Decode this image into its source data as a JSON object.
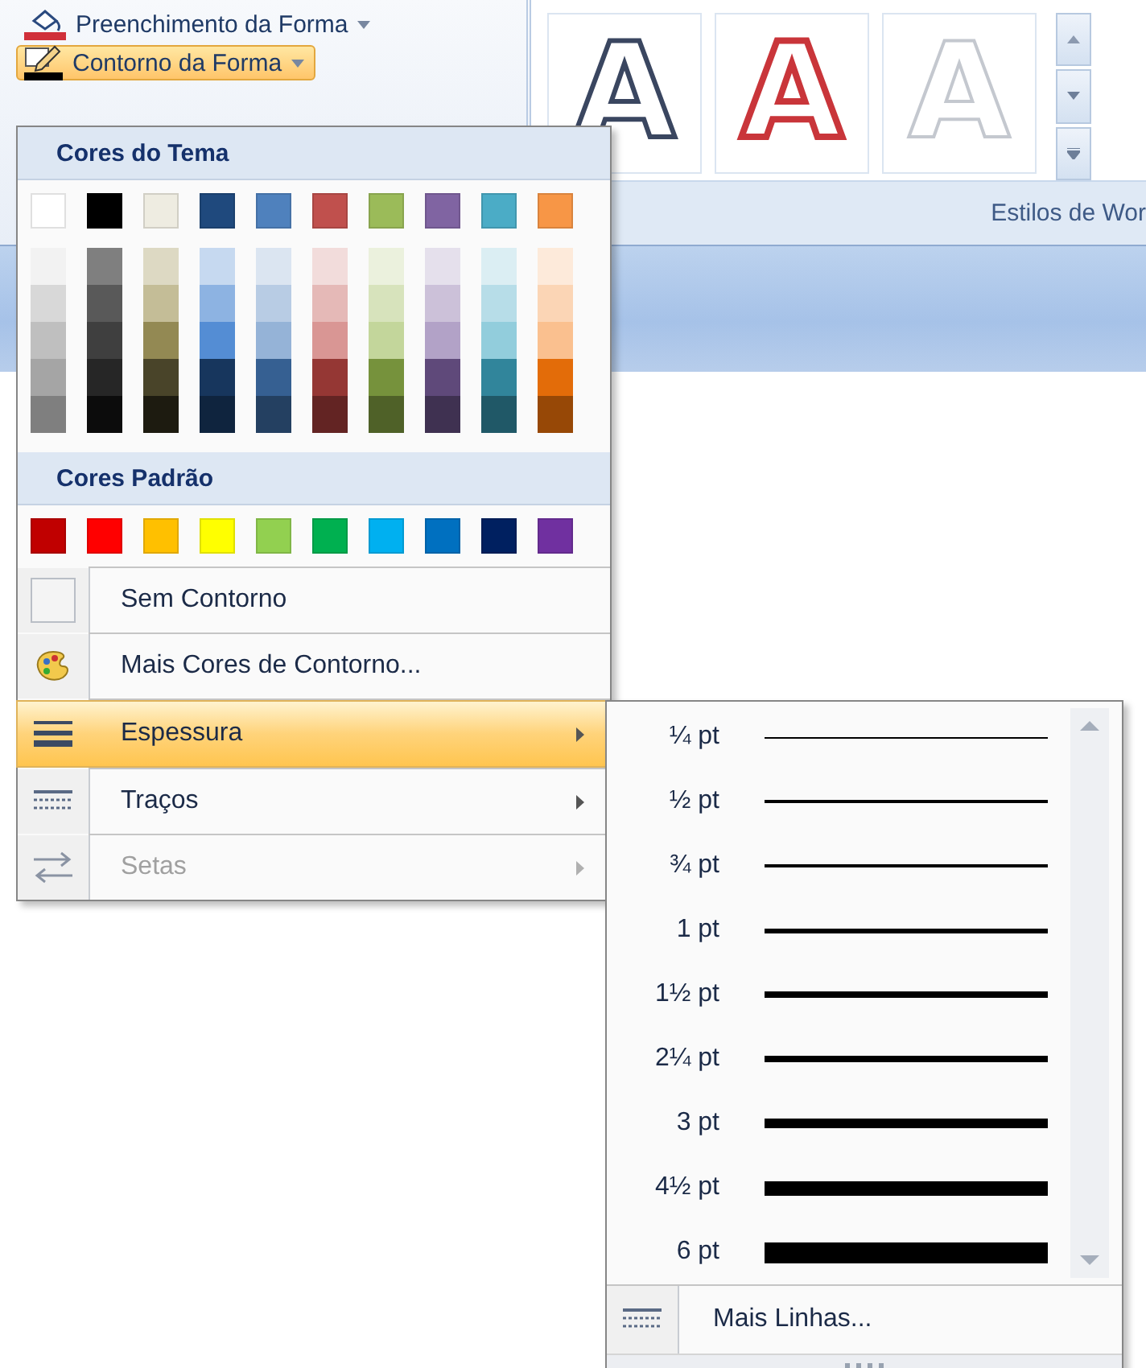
{
  "ribbon": {
    "buttons": [
      {
        "label": "Preenchimento da Forma",
        "kind": "fill",
        "selected": false
      },
      {
        "label": "Contorno da Forma",
        "kind": "outline",
        "selected": true
      }
    ],
    "gallery": [
      {
        "letter": "A",
        "kind": "outline"
      },
      {
        "letter": "A",
        "kind": "red"
      },
      {
        "letter": "A",
        "kind": "white"
      }
    ],
    "group_label": "Estilos de Wor"
  },
  "menu": {
    "theme_header": "Cores do Tema",
    "theme_colors": [
      {
        "color": "#ffffff"
      },
      {
        "color": "#000000"
      },
      {
        "color": "#eeece1"
      },
      {
        "color": "#1f497d"
      },
      {
        "color": "#4f81bd"
      },
      {
        "color": "#c0504d"
      },
      {
        "color": "#9bbb59"
      },
      {
        "color": "#8064a2"
      },
      {
        "color": "#4bacc6"
      },
      {
        "color": "#f79646"
      }
    ],
    "theme_shades": [
      {
        "shades": [
          {
            "color": "#f2f2f2"
          },
          {
            "color": "#d8d8d8"
          },
          {
            "color": "#bfbfbf"
          },
          {
            "color": "#a5a5a5"
          },
          {
            "color": "#7f7f7f"
          }
        ]
      },
      {
        "shades": [
          {
            "color": "#7f7f7f"
          },
          {
            "color": "#595959"
          },
          {
            "color": "#3f3f3f"
          },
          {
            "color": "#262626"
          },
          {
            "color": "#0c0c0c"
          }
        ]
      },
      {
        "shades": [
          {
            "color": "#ddd9c3"
          },
          {
            "color": "#c4bd97"
          },
          {
            "color": "#938953"
          },
          {
            "color": "#494429"
          },
          {
            "color": "#1d1b10"
          }
        ]
      },
      {
        "shades": [
          {
            "color": "#c6d9f0"
          },
          {
            "color": "#8db3e2"
          },
          {
            "color": "#548dd4"
          },
          {
            "color": "#17365d"
          },
          {
            "color": "#0f243e"
          }
        ]
      },
      {
        "shades": [
          {
            "color": "#dbe5f1"
          },
          {
            "color": "#b8cce4"
          },
          {
            "color": "#95b3d7"
          },
          {
            "color": "#366092"
          },
          {
            "color": "#244061"
          }
        ]
      },
      {
        "shades": [
          {
            "color": "#f2dcdb"
          },
          {
            "color": "#e5b9b7"
          },
          {
            "color": "#d99694"
          },
          {
            "color": "#953734"
          },
          {
            "color": "#632423"
          }
        ]
      },
      {
        "shades": [
          {
            "color": "#ebf1dd"
          },
          {
            "color": "#d7e3bc"
          },
          {
            "color": "#c3d69b"
          },
          {
            "color": "#76923c"
          },
          {
            "color": "#4f6128"
          }
        ]
      },
      {
        "shades": [
          {
            "color": "#e5e0ec"
          },
          {
            "color": "#ccc1d9"
          },
          {
            "color": "#b2a2c7"
          },
          {
            "color": "#5f497a"
          },
          {
            "color": "#3f3151"
          }
        ]
      },
      {
        "shades": [
          {
            "color": "#dbeef3"
          },
          {
            "color": "#b7dde8"
          },
          {
            "color": "#92cddc"
          },
          {
            "color": "#31859b"
          },
          {
            "color": "#205867"
          }
        ]
      },
      {
        "shades": [
          {
            "color": "#fdeada"
          },
          {
            "color": "#fbd5b5"
          },
          {
            "color": "#fac08f"
          },
          {
            "color": "#e36c09"
          },
          {
            "color": "#974806"
          }
        ]
      }
    ],
    "standard_header": "Cores Padrão",
    "standard_colors": [
      {
        "color": "#c00000"
      },
      {
        "color": "#ff0000"
      },
      {
        "color": "#ffc000"
      },
      {
        "color": "#ffff00"
      },
      {
        "color": "#92d050"
      },
      {
        "color": "#00b050"
      },
      {
        "color": "#00b0f0"
      },
      {
        "color": "#0070c0"
      },
      {
        "color": "#002060"
      },
      {
        "color": "#7030a0"
      }
    ],
    "items": [
      {
        "label": "Sem Contorno",
        "kind": "no-outline",
        "submenu": false,
        "selected": false,
        "disabled": false
      },
      {
        "label": "Mais Cores de Contorno...",
        "kind": "more-colors",
        "submenu": false,
        "selected": false,
        "disabled": false
      },
      {
        "label": "Espessura",
        "kind": "weight",
        "submenu": true,
        "selected": true,
        "disabled": false
      },
      {
        "label": "Traços",
        "kind": "dashes",
        "submenu": true,
        "selected": false,
        "disabled": false
      },
      {
        "label": "Setas",
        "kind": "arrows",
        "submenu": true,
        "selected": false,
        "disabled": true
      }
    ]
  },
  "submenu": {
    "weights": [
      {
        "label": "¼ pt"
      },
      {
        "label": "½ pt"
      },
      {
        "label": "¾ pt"
      },
      {
        "label": "1 pt"
      },
      {
        "label": "1½ pt"
      },
      {
        "label": "2¼ pt"
      },
      {
        "label": "3 pt"
      },
      {
        "label": "4½ pt"
      },
      {
        "label": "6 pt"
      }
    ],
    "more": {
      "label": "Mais Linhas...",
      "kind": "dashes"
    }
  }
}
